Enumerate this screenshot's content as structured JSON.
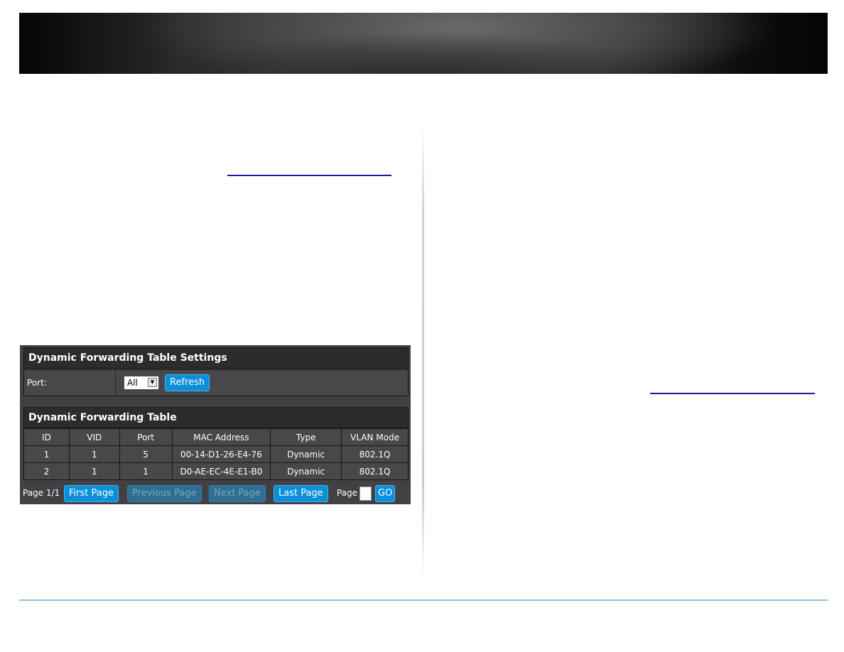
{
  "document": {
    "banner_name": "header-banner"
  },
  "panel": {
    "settings_title": "Dynamic Forwarding Table Settings",
    "port_label": "Port:",
    "port_select_value": "All",
    "refresh_label": "Refresh",
    "table_title": "Dynamic Forwarding Table",
    "columns": [
      "ID",
      "VID",
      "Port",
      "MAC Address",
      "Type",
      "VLAN Mode"
    ],
    "rows": [
      [
        "1",
        "1",
        "5",
        "00-14-D1-26-E4-76",
        "Dynamic",
        "802.1Q"
      ],
      [
        "2",
        "1",
        "1",
        "D0-AE-EC-4E-E1-B0",
        "Dynamic",
        "802.1Q"
      ]
    ],
    "pager": {
      "page_status": "Page 1/1",
      "first_label": "First Page",
      "previous_label": "Previous Page",
      "next_label": "Next Page",
      "last_label": "Last Page",
      "page_label": "Page",
      "page_input_value": "",
      "go_label": "GO"
    }
  },
  "colors": {
    "button_blue": "#0b8fd8",
    "panel_dark": "#414144",
    "link_blue": "#1a1aa6",
    "footer_rule": "#9dbcdc"
  }
}
